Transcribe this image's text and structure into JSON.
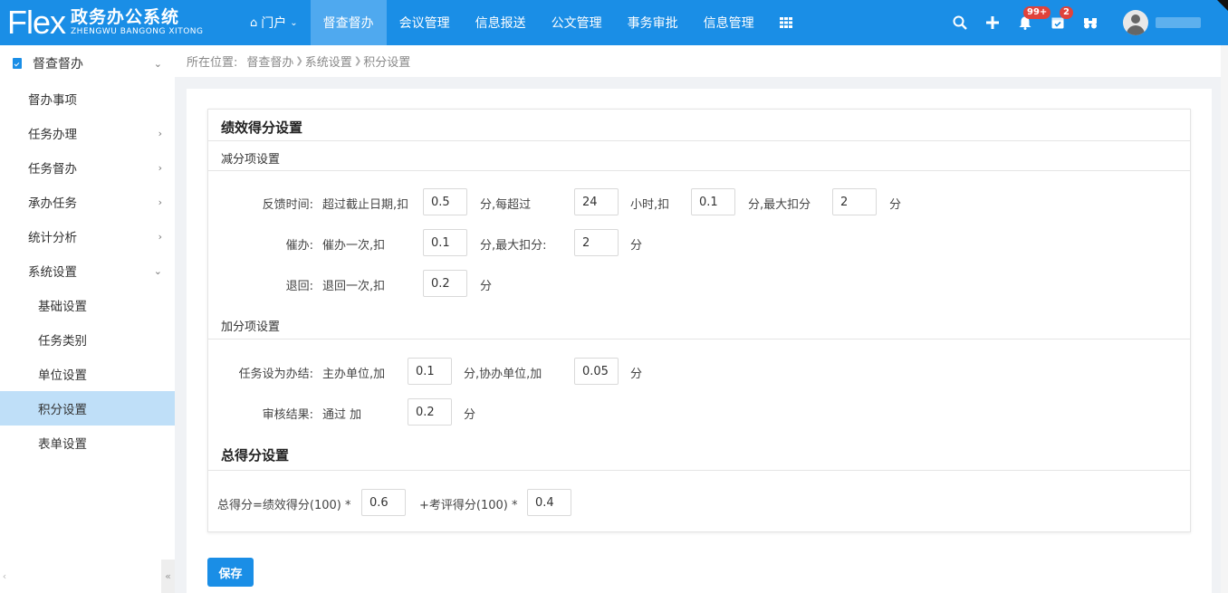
{
  "header": {
    "logo_mark": "Flex",
    "logo_title": "政务办公系统",
    "logo_subtitle": "ZHENGWU BANGONG XITONG",
    "nav": [
      {
        "label": "门户",
        "icon": "home-icon",
        "has_dropdown": true
      },
      {
        "label": "督查督办",
        "active": true
      },
      {
        "label": "会议管理"
      },
      {
        "label": "信息报送"
      },
      {
        "label": "公文管理"
      },
      {
        "label": "事务审批"
      },
      {
        "label": "信息管理"
      },
      {
        "label": "",
        "icon": "grid-icon"
      }
    ],
    "notif_badge": "99+",
    "mail_badge": "2"
  },
  "sidebar": {
    "section_title": "督查督办",
    "items": [
      {
        "label": "督办事项"
      },
      {
        "label": "任务办理",
        "chevron": "›"
      },
      {
        "label": "任务督办",
        "chevron": "›"
      },
      {
        "label": "承办任务",
        "chevron": "›"
      },
      {
        "label": "统计分析",
        "chevron": "›"
      },
      {
        "label": "系统设置",
        "chevron": "⌄"
      },
      {
        "label": "基础设置"
      },
      {
        "label": "任务类别"
      },
      {
        "label": "单位设置"
      },
      {
        "label": "积分设置",
        "active": true
      },
      {
        "label": "表单设置"
      }
    ],
    "collapse_glyph": "«",
    "left_glyph": "‹"
  },
  "breadcrumb": {
    "prefix": "所在位置:",
    "items": [
      "督查督办",
      "系统设置",
      "积分设置"
    ]
  },
  "form": {
    "performance_title": "绩效得分设置",
    "deduct_title": "减分项设置",
    "feedback": {
      "label": "反馈时间:",
      "t1": "超过截止日期,扣",
      "v1": "0.5",
      "t2": "分,每超过",
      "v2": "24",
      "t3": "小时,扣",
      "v3": "0.1",
      "t4": "分,最大扣分",
      "v4": "2",
      "t5": "分"
    },
    "urge": {
      "label": "催办:",
      "t1": "催办一次,扣",
      "v1": "0.1",
      "t2": "分,最大扣分:",
      "v2": "2",
      "t3": "分"
    },
    "back": {
      "label": "退回:",
      "t1": "退回一次,扣",
      "v1": "0.2",
      "t2": "分"
    },
    "add_title": "加分项设置",
    "finish": {
      "label": "任务设为办结:",
      "t1": "主办单位,加",
      "v1": "0.1",
      "t2": "分,协办单位,加",
      "v2": "0.05",
      "t3": "分"
    },
    "review": {
      "label": "审核结果:",
      "t1": "通过 加",
      "v1": "0.2",
      "t2": "分"
    },
    "total_title": "总得分设置",
    "total": {
      "t1": "总得分=绩效得分(100) *",
      "v1": "0.6",
      "t2": "+考评得分(100) *",
      "v2": "0.4"
    },
    "save_label": "保存"
  },
  "colors": {
    "primary": "#1a8ee6",
    "nav_active": "#4fa9ef",
    "side_active": "#bfdff8",
    "badge": "#e0433b"
  }
}
